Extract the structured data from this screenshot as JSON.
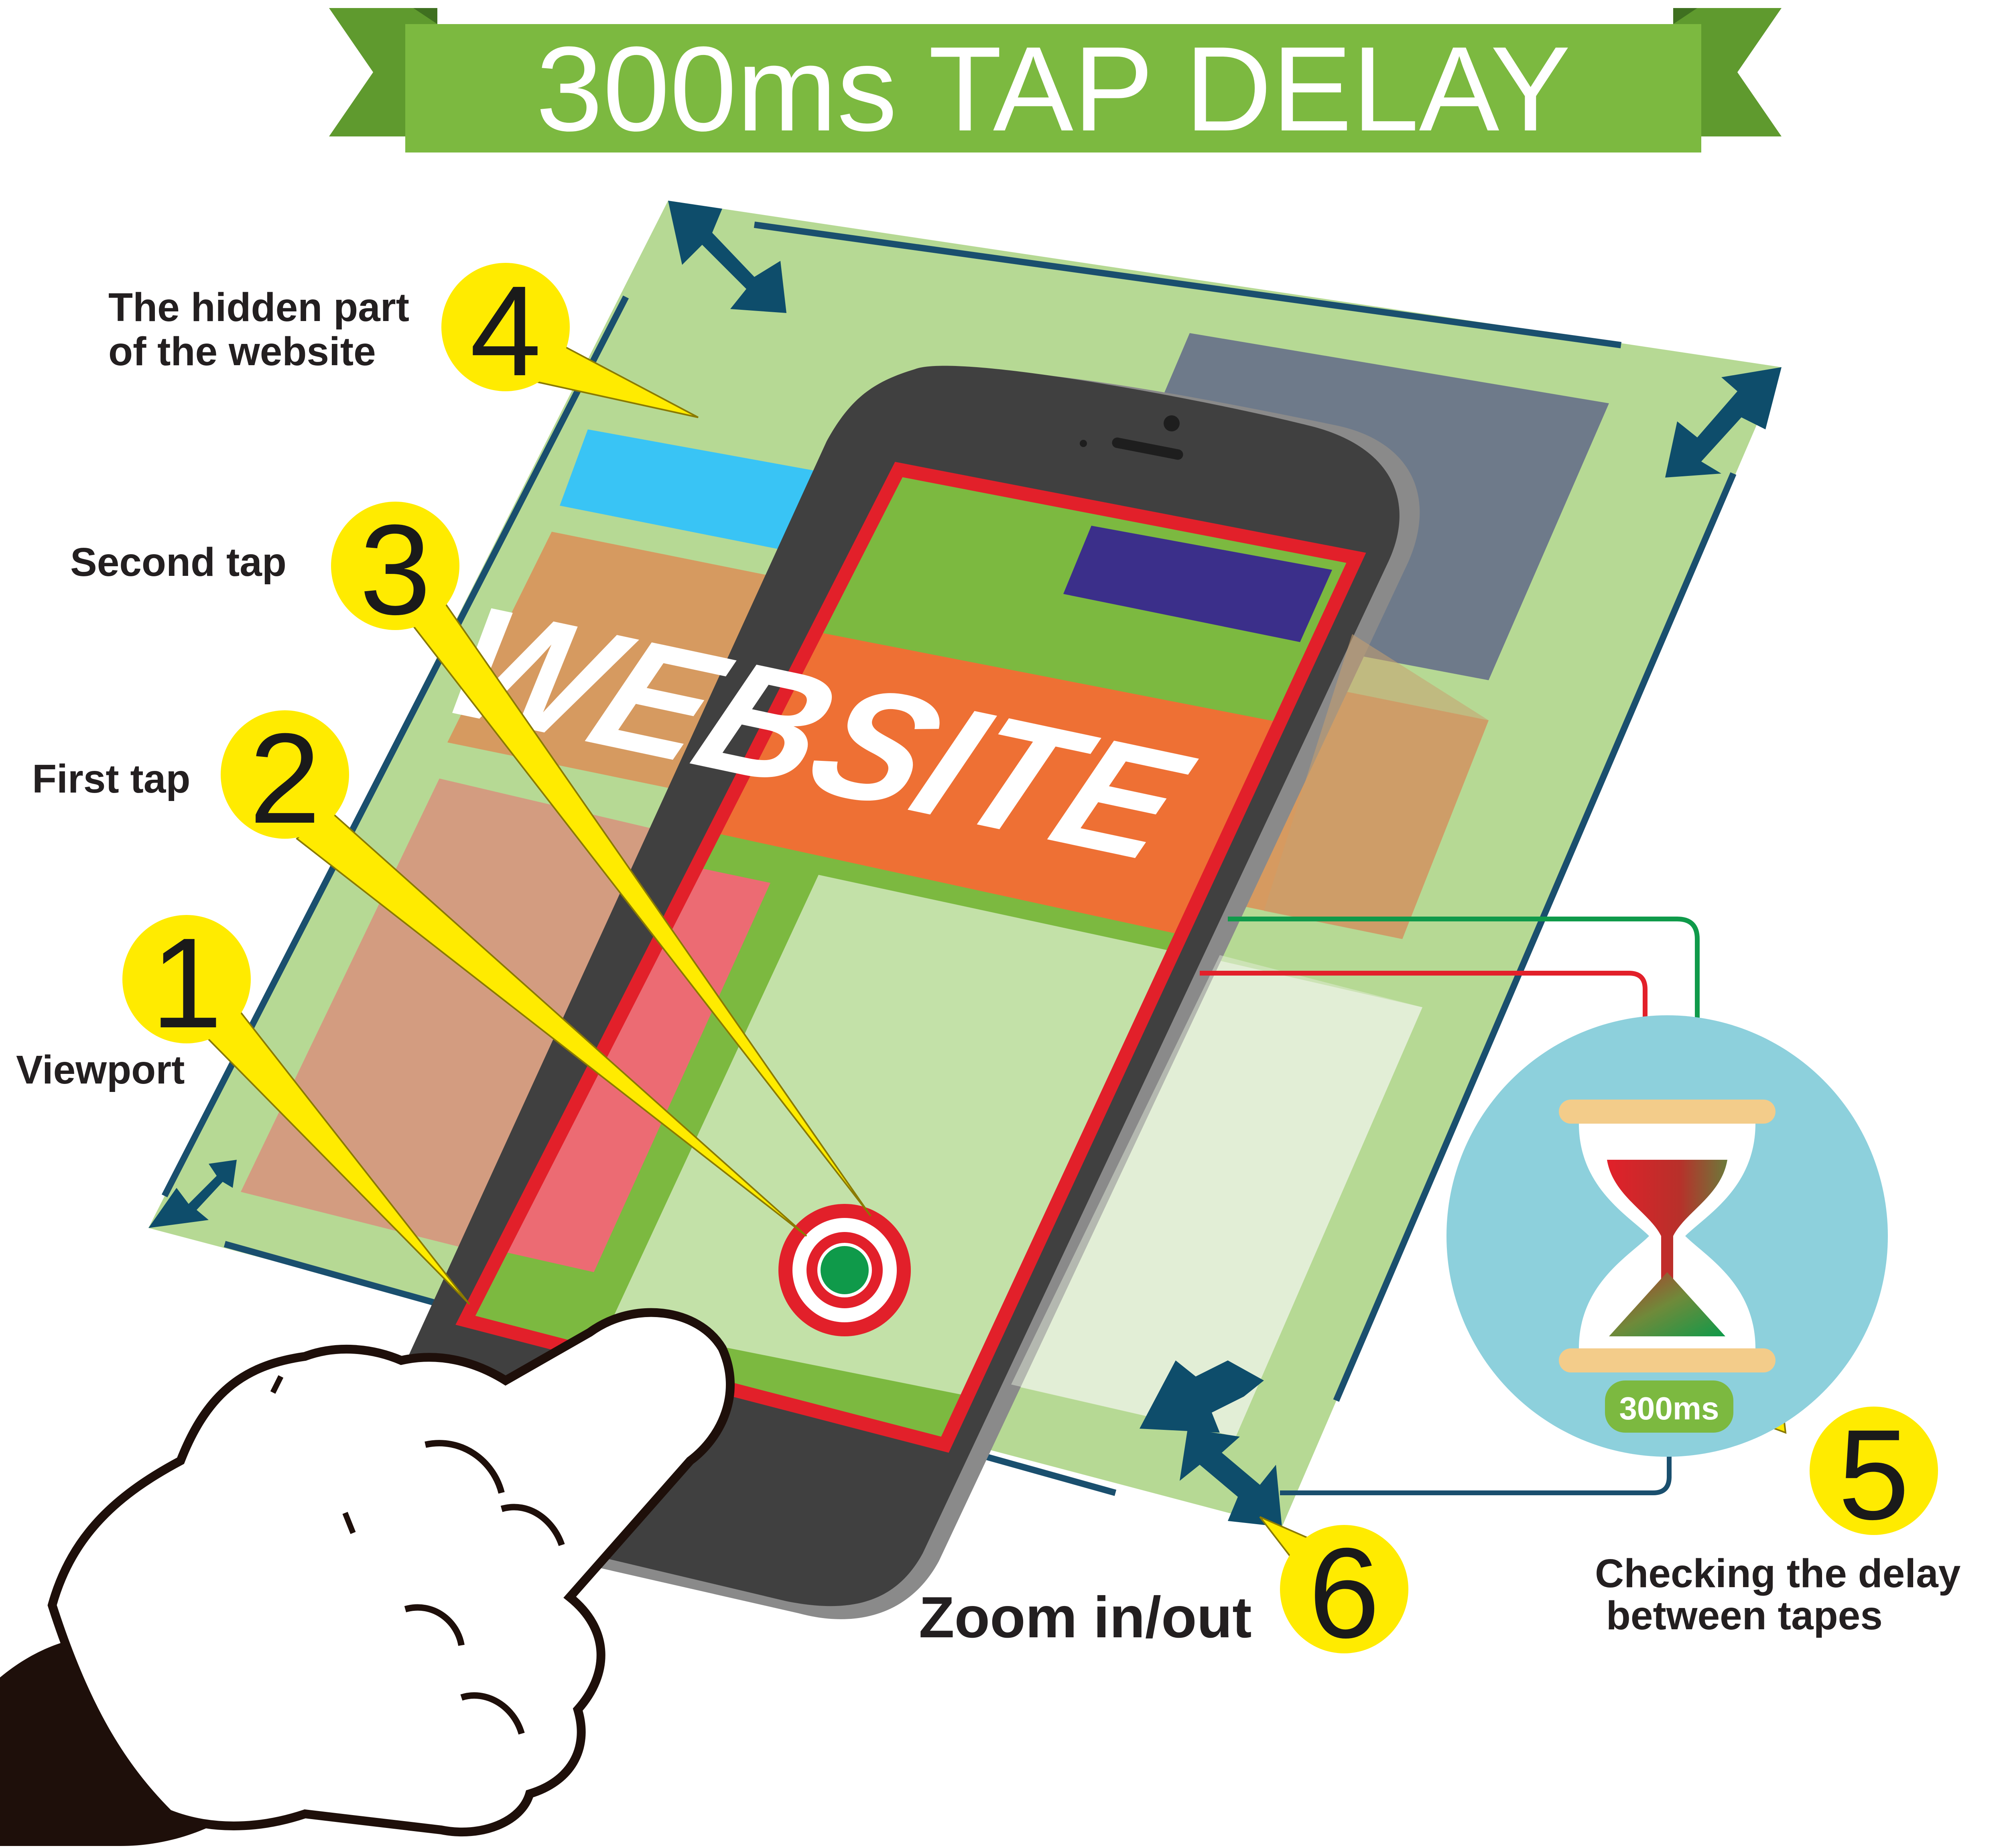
{
  "title": "300ms TAP DELAY",
  "website_word": "WEBSITE",
  "callouts": [
    {
      "number": "1",
      "label": "Viewport"
    },
    {
      "number": "2",
      "label": "First tap"
    },
    {
      "number": "3",
      "label": "Second tap"
    },
    {
      "number": "4",
      "label_lines": [
        "The hidden part",
        "of the website"
      ]
    },
    {
      "number": "5",
      "label_lines": [
        "Checking the delay",
        " between tapes"
      ]
    },
    {
      "number": "6",
      "label": "Zoom in/out"
    }
  ],
  "timer_badge": "300ms",
  "colors": {
    "banner": "#7cb940",
    "page_bg": "#b6d994",
    "page_border": "#1a4f6e",
    "viewport_frame": "#e2202a",
    "callout_yellow": "#ffeb00",
    "hourglass_circle": "#8dd0dc",
    "zoom_arrows": "#0e4d6b",
    "blue_bar": "#39c4f5",
    "gray_block": "#6e7a8a",
    "orange_band": "#d69a60",
    "phone_body": "#404040"
  }
}
